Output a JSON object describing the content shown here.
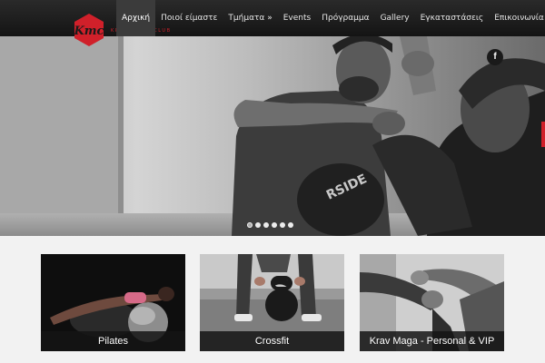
{
  "brand": {
    "logo_text": "Kmc",
    "tagline": "KRAV MAGA CLUB"
  },
  "nav": {
    "items": [
      {
        "label": "Αρχική",
        "active": true
      },
      {
        "label": "Ποιοί είμαστε"
      },
      {
        "label": "Τμήματα »"
      },
      {
        "label": "Events"
      },
      {
        "label": "Πρόγραμμα"
      },
      {
        "label": "Gallery"
      },
      {
        "label": "Εγκαταστάσεις"
      },
      {
        "label": "Επικοινωνία"
      }
    ]
  },
  "hero": {
    "social_icon": "facebook-icon",
    "social_glyph": "f",
    "slides_count": 6,
    "active_slide": 1
  },
  "cards": [
    {
      "label": "Pilates"
    },
    {
      "label": "Crossfit"
    },
    {
      "label": "Krav Maga - Personal & VIP"
    }
  ],
  "colors": {
    "accent": "#d0202a",
    "header_bg": "#1c1c1c",
    "page_bg": "#f2f2f2"
  }
}
